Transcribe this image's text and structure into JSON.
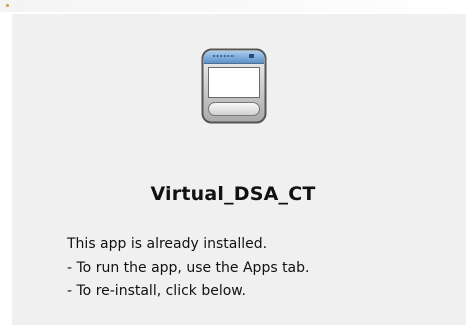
{
  "app": {
    "name": "Virtual_DSA_CT",
    "icon": "app-window-icon"
  },
  "message": {
    "line1": "This app is already installed.",
    "line2": "- To run the app, use the Apps tab.",
    "line3": "- To re-install, click below."
  },
  "colors": {
    "panel_background": "#f0f0f0",
    "text": "#111111",
    "icon_titlebar": "#6a9bd0"
  }
}
